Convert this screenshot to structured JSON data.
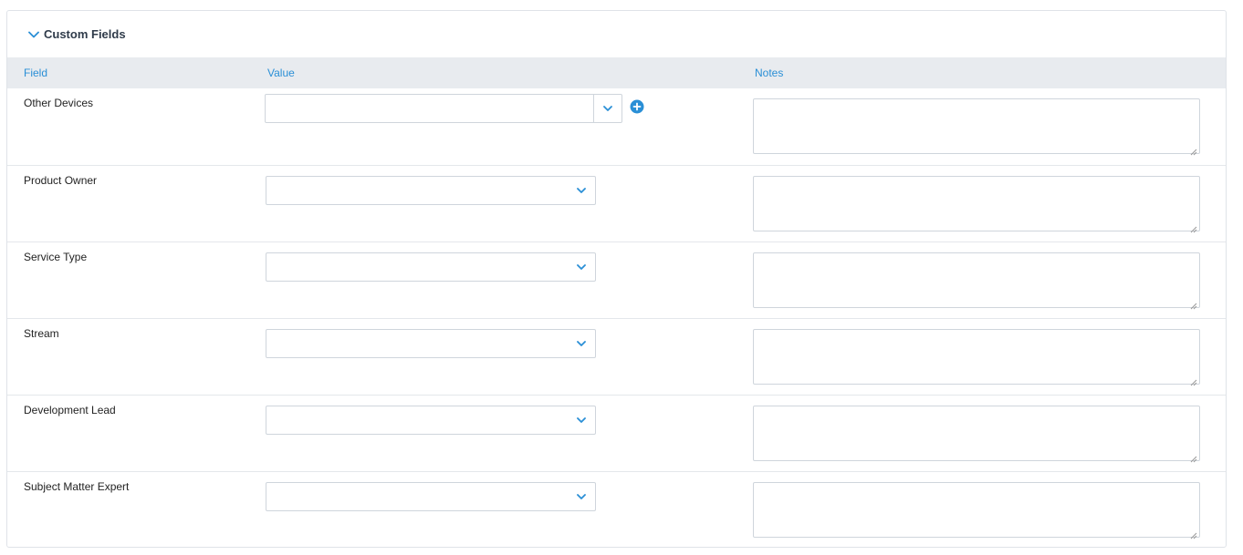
{
  "panel": {
    "title": "Custom Fields"
  },
  "columns": {
    "field": "Field",
    "value": "Value",
    "notes": "Notes"
  },
  "rows": [
    {
      "label": "Other Devices",
      "value": "",
      "notes": ""
    },
    {
      "label": "Product Owner",
      "value": "",
      "notes": ""
    },
    {
      "label": "Service Type",
      "value": "",
      "notes": ""
    },
    {
      "label": "Stream",
      "value": "",
      "notes": ""
    },
    {
      "label": "Development Lead",
      "value": "",
      "notes": ""
    },
    {
      "label": "Subject Matter Expert",
      "value": "",
      "notes": ""
    }
  ],
  "colors": {
    "accent": "#2a8fd6",
    "header_bg": "#e8ebef",
    "border": "#cfd5dc"
  },
  "icons": {
    "collapse": "chevron-down-icon",
    "dropdown": "chevron-down-icon",
    "add": "plus-circle-icon",
    "resize": "resize-handle-icon"
  }
}
